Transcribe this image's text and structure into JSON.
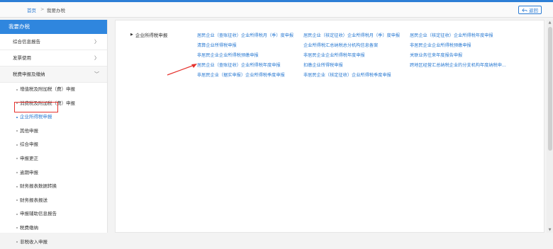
{
  "breadcrumb": {
    "home": "首页",
    "separator": ">",
    "current": "我要办税"
  },
  "back_button": {
    "label": "返回"
  },
  "sidebar": {
    "title": "我要办税",
    "items": [
      {
        "label": "综合信息报告",
        "chevron": "〉"
      },
      {
        "label": "发票使用",
        "chevron": "〉"
      },
      {
        "label": "税费申报及缴纳",
        "chevron": "﹀"
      }
    ],
    "sub_items": [
      {
        "label": "增值税及附加税（费）申报"
      },
      {
        "label": "消费税及附加税（费）申报"
      },
      {
        "label": "企业所得税申报"
      },
      {
        "label": "其他申报"
      },
      {
        "label": "综合申报"
      },
      {
        "label": "申报更正"
      },
      {
        "label": "逾期申报"
      },
      {
        "label": "财务报表数据转换"
      },
      {
        "label": "财务报表报送"
      },
      {
        "label": "申报辅助信息报告"
      },
      {
        "label": "税费缴纳"
      },
      {
        "label": "非税收入申报"
      }
    ]
  },
  "main": {
    "category": "企业所得税申报",
    "links": [
      "居民企业（查账征收）企业所得税月（季）度申报",
      "居民企业（核定征收）企业所得税月（季）度申报",
      "居民企业（核定征收）企业所得税年度申报",
      "清算企业所得税申报",
      "企业所得税汇总纳税总分机构信息备案",
      "非居民企业企业所得税预缴申报",
      "非居民企业企业所得税预缴申报",
      "非居民企业企业所得税年度申报",
      "关联业务往来年度报告申报",
      "居民企业（查账征收）企业所得税年度申报",
      "扣缴企业所得税申报",
      "跨地区经营汇总纳税企业的分支机构年度纳税申...",
      "非居民企业（据实申报）企业所得税季度申报",
      "非居民企业（核定征收）企业所得税季度申报"
    ]
  },
  "colors": {
    "accent": "#2f86de",
    "link": "#2a7ad2",
    "annotation": "#e5322d"
  }
}
